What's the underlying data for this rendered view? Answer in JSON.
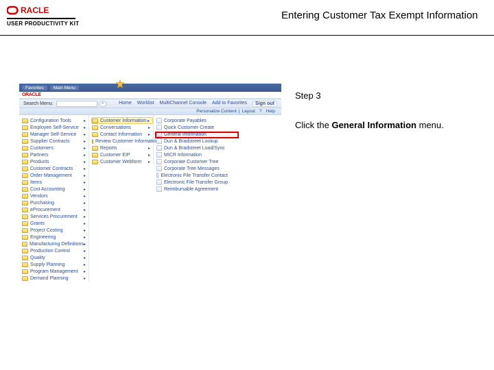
{
  "header": {
    "logo_brand": "ORACLE",
    "logo_sub": "USER PRODUCTIVITY KIT",
    "doc_title": "Entering Customer Tax Exempt Information"
  },
  "right": {
    "step_label": "Step 3",
    "instr_prefix": "Click the ",
    "instr_bold": "General Information",
    "instr_suffix": " menu."
  },
  "shot": {
    "top_tabs": [
      "Favorites",
      "Main Menu"
    ],
    "mini_brand": "ORACLE",
    "nav": {
      "search_label": "Search Menu:",
      "links": [
        "Home",
        "Worklist",
        "MultiChannel Console",
        "Add to Favorites"
      ],
      "signout": "Sign out"
    },
    "breadcrumb": [
      "Personalize Content",
      "Layout",
      "?",
      "Help"
    ],
    "col1": [
      "Configuration Tools",
      "Employee Self-Service",
      "Manager Self-Service",
      "Supplier Contracts",
      "Customers",
      "Partners",
      "Products",
      "Customer Contracts",
      "Order Management",
      "Items",
      "Cost Accounting",
      "Vendors",
      "Purchasing",
      "eProcurement",
      "Services Procurement",
      "Grants",
      "Project Costing",
      "Engineering",
      "Manufacturing Definitions",
      "Production Control",
      "Quality",
      "Supply Planning",
      "Program Management",
      "Demand Planning"
    ],
    "col2": [
      "Customer Information",
      "Conversations",
      "Contact Information",
      "Review Customer Information",
      "Reports",
      "Customer EIP",
      "Customer Webform"
    ],
    "col2_selected_index": 0,
    "col3": [
      "Corporate Payables",
      "Quick Customer Create",
      "General Information",
      "Dun & Bradstreet Lookup",
      "Dun & Bradstreet Load/Sync",
      "MICR Information",
      "Corporate Customer Tree",
      "Corporate Tree Messages",
      "Electronic File Transfer Contact",
      "Electronic File Transfer Group",
      "Reimbursable Agreement"
    ],
    "star_badge": true,
    "highlight_target_index": 2
  }
}
